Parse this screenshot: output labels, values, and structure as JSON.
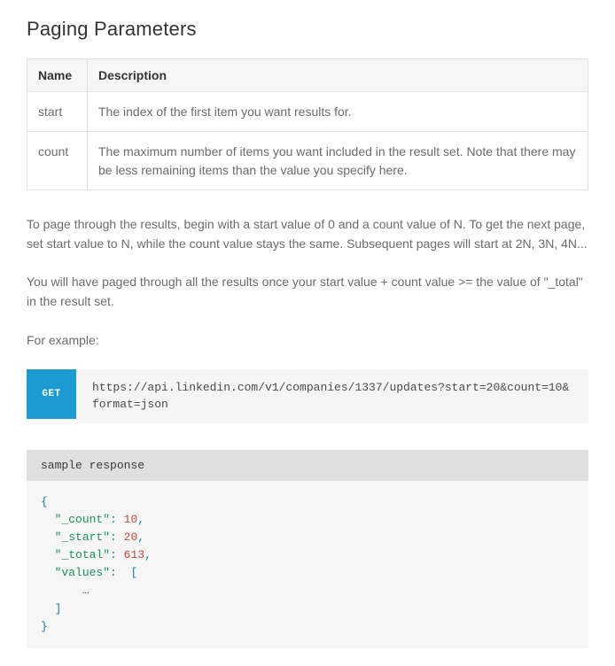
{
  "title": "Paging Parameters",
  "table": {
    "headers": {
      "name": "Name",
      "description": "Description"
    },
    "rows": [
      {
        "name": "start",
        "description": "The index of the first item you want results for."
      },
      {
        "name": "count",
        "description": "The maximum number of items you want included in the result set.  Note that there may be less remaining items than the value you specify here."
      }
    ]
  },
  "paragraphs": {
    "p1": "To page through the results, begin with a start value of 0 and a count value of N.  To get the next page, set start value to N, while the count value stays the same.  Subsequent pages will start at 2N, 3N, 4N...",
    "p2": "You will have paged through all the results once your start value + count value >= the value of \"_total\" in the result set.",
    "p3": "For example:"
  },
  "http": {
    "method": "GET",
    "url": "https://api.linkedin.com/v1/companies/1337/updates?start=20&count=10&format=json"
  },
  "sample": {
    "label": "sample response",
    "keys": {
      "count": "\"_count\"",
      "start": "\"_start\"",
      "total": "\"_total\"",
      "values": "\"values\""
    },
    "vals": {
      "count": "10",
      "start": "20",
      "total": "613"
    },
    "ellipsis": "…"
  }
}
